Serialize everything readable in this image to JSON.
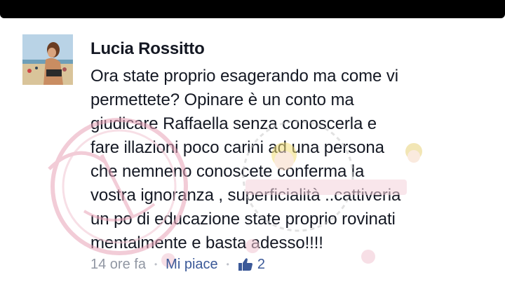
{
  "comment": {
    "author": "Lucia Rossitto",
    "avatar_icon": "profile-photo",
    "lines": [
      "Ora state proprio esagerando ma come vi",
      "permettete? Opinare è un conto ma",
      "giudicare Raffaella senza conoscerla e",
      "fare illazioni poco carini ad una persona",
      "che nemneno conoscete conferma la",
      "vostra ignoranza , superficialità ..cattiveria",
      "un po di educazione state proprio rovinati",
      "mentalmente e basta adesso!!!!"
    ],
    "timestamp": "14 ore fa",
    "separator": "•",
    "like_label": "Mi piace",
    "like_icon": "thumbs-up-icon",
    "like_count": "2"
  },
  "colors": {
    "text": "#141823",
    "meta": "#9197a3",
    "link": "#3b5998",
    "watermark": "#e8a3b8"
  }
}
